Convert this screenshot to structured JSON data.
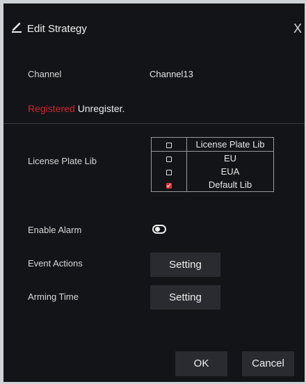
{
  "dialog": {
    "title": "Edit Strategy",
    "close_glyph": "X",
    "title_icon": "pencil-icon"
  },
  "channel": {
    "label": "Channel",
    "value": "Channel13"
  },
  "registration": {
    "registered": "Registered",
    "unregister": "Unregister."
  },
  "license_plate_lib": {
    "label": "License Plate Lib",
    "header": "License Plate Lib",
    "items": [
      {
        "name": "EU",
        "checked": false
      },
      {
        "name": "EUA",
        "checked": false
      },
      {
        "name": "Default Lib",
        "checked": true
      }
    ]
  },
  "enable_alarm": {
    "label": "Enable Alarm",
    "on": false
  },
  "event_actions": {
    "label": "Event Actions",
    "button": "Setting"
  },
  "arming_time": {
    "label": "Arming Time",
    "button": "Setting"
  },
  "footer": {
    "ok": "OK",
    "cancel": "Cancel"
  },
  "colors": {
    "background": "#131418",
    "accent_red": "#d0262c",
    "button": "#2a2b30"
  }
}
